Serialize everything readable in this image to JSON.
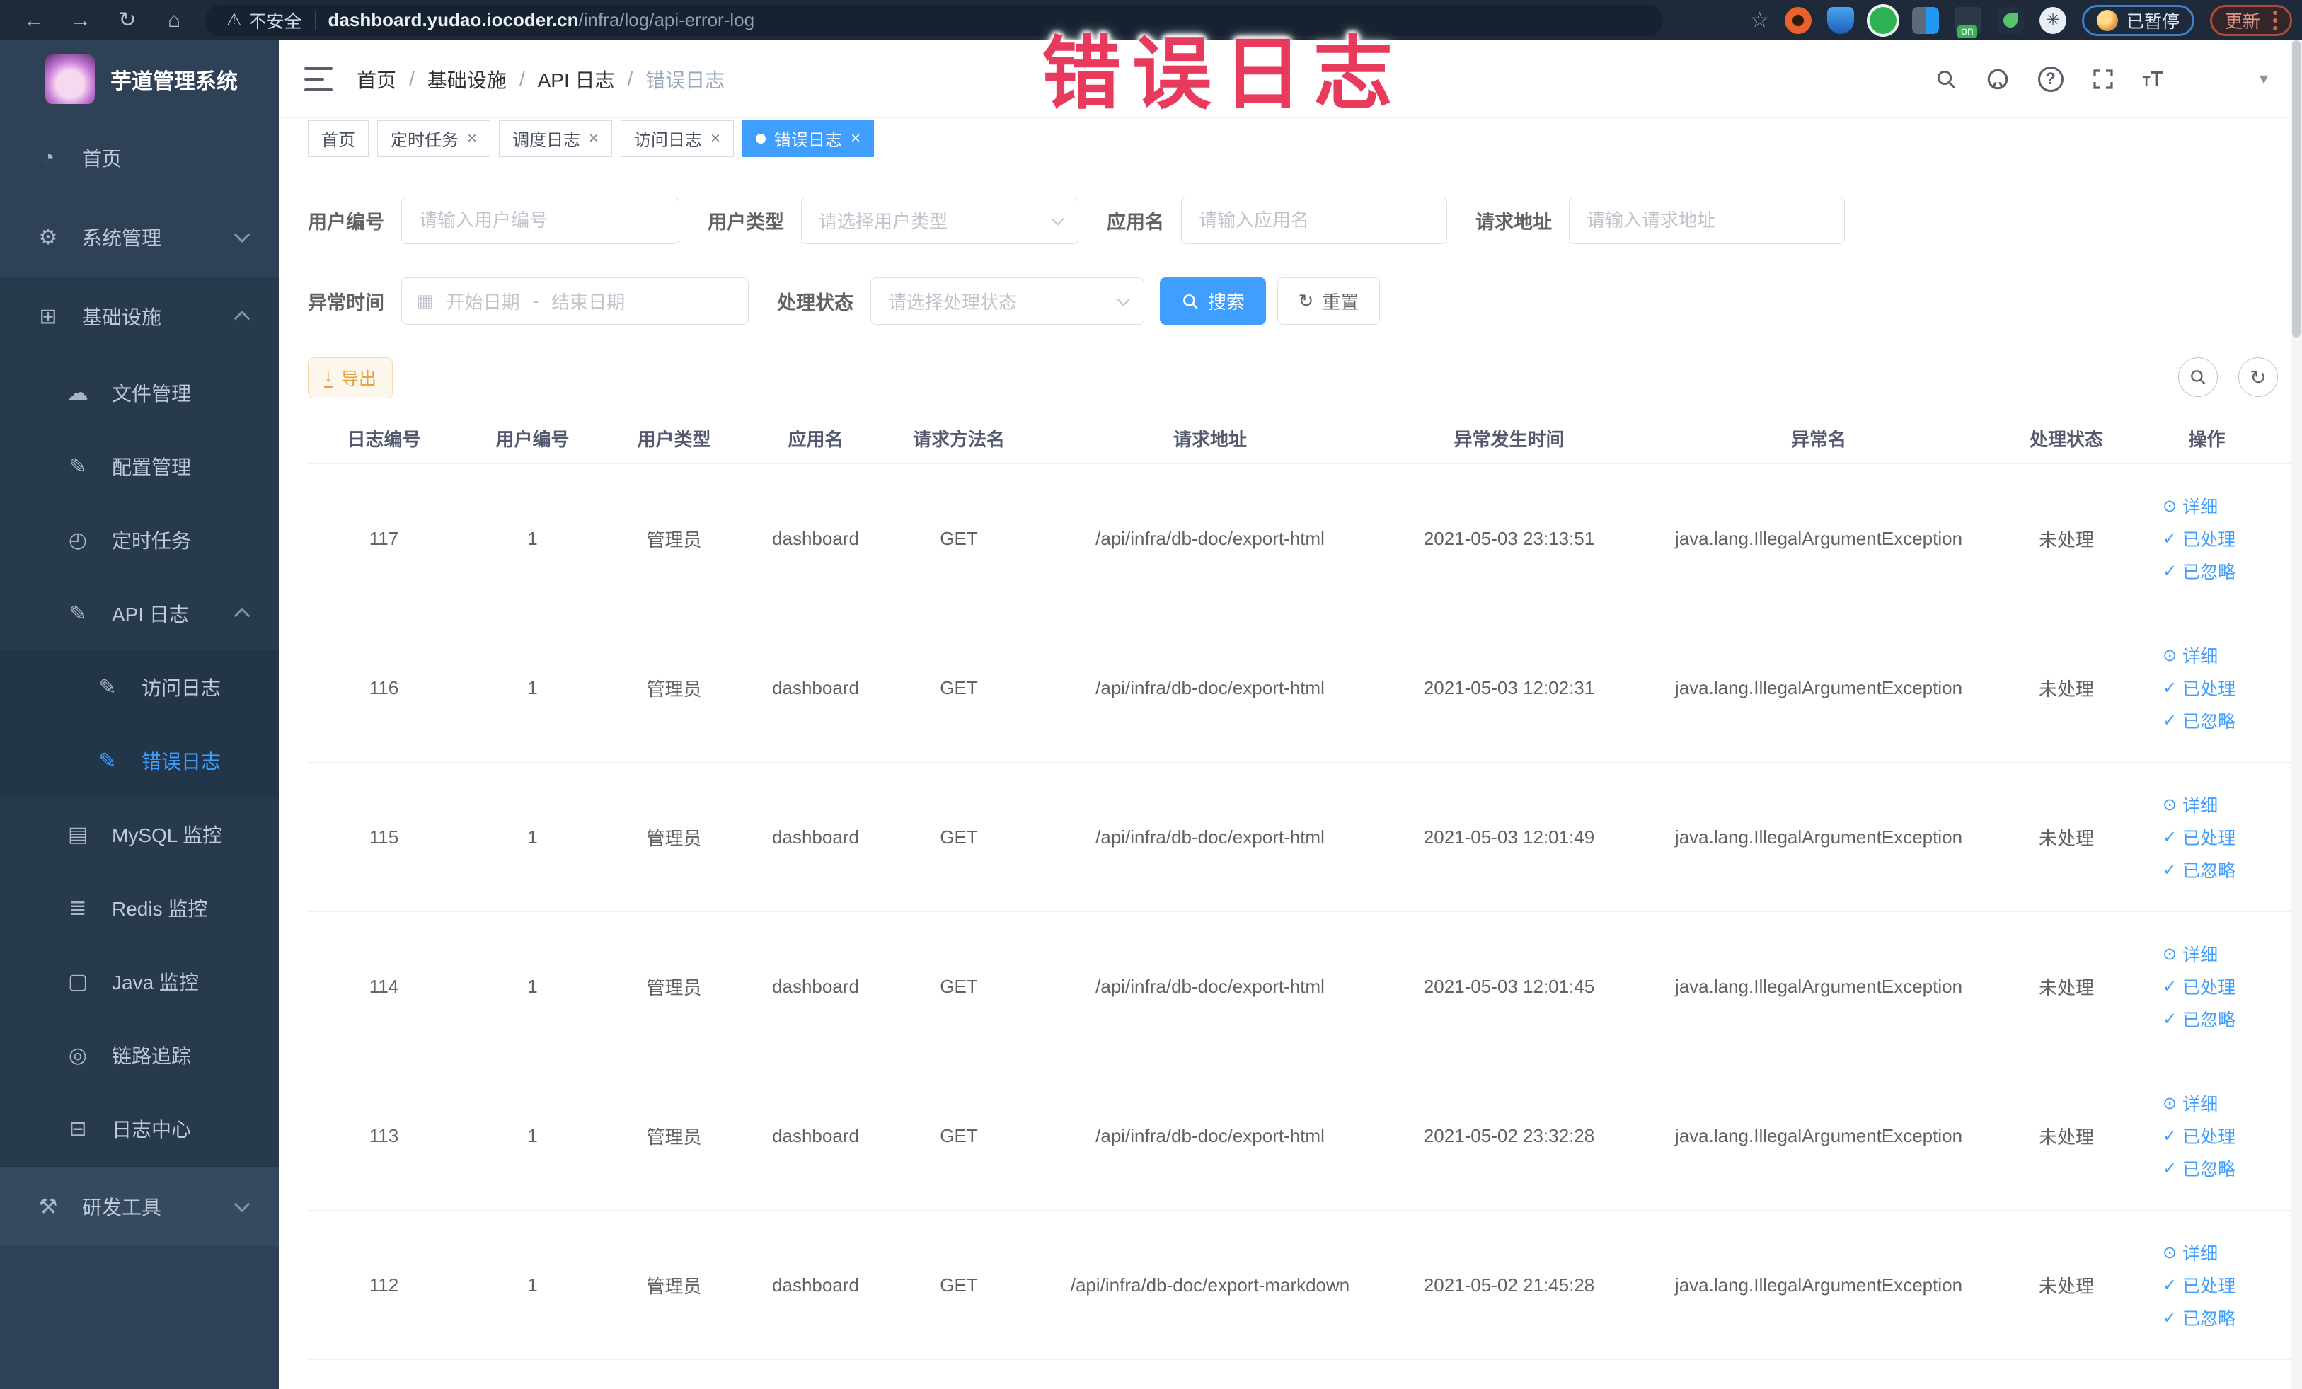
{
  "browser": {
    "insecure_label": "不安全",
    "url_domain": "dashboard.yudao.iocoder.cn",
    "url_path": "/infra/log/api-error-log",
    "paused_label": "已暂停",
    "update_label": "更新"
  },
  "overlay": {
    "text": "错误日志",
    "color": "#e83a5c"
  },
  "sidebar": {
    "title": "芋道管理系统",
    "items": [
      {
        "label": "首页"
      },
      {
        "label": "系统管理"
      },
      {
        "label": "基础设施"
      },
      {
        "label": "文件管理"
      },
      {
        "label": "配置管理"
      },
      {
        "label": "定时任务"
      },
      {
        "label": "API 日志"
      },
      {
        "label": "访问日志"
      },
      {
        "label": "错误日志"
      },
      {
        "label": "MySQL 监控"
      },
      {
        "label": "Redis 监控"
      },
      {
        "label": "Java 监控"
      },
      {
        "label": "链路追踪"
      },
      {
        "label": "日志中心"
      },
      {
        "label": "研发工具"
      }
    ]
  },
  "breadcrumb": {
    "items": [
      "首页",
      "基础设施",
      "API 日志",
      "错误日志"
    ],
    "separator": "/"
  },
  "tabs": [
    {
      "label": "首页",
      "closable": false,
      "active": false
    },
    {
      "label": "定时任务",
      "closable": true,
      "active": false
    },
    {
      "label": "调度日志",
      "closable": true,
      "active": false
    },
    {
      "label": "访问日志",
      "closable": true,
      "active": false
    },
    {
      "label": "错误日志",
      "closable": true,
      "active": true
    }
  ],
  "close_glyph": "×",
  "filters": {
    "user_id": {
      "label": "用户编号",
      "placeholder": "请输入用户编号"
    },
    "user_type": {
      "label": "用户类型",
      "placeholder": "请选择用户类型"
    },
    "app_name": {
      "label": "应用名",
      "placeholder": "请输入应用名"
    },
    "request_url": {
      "label": "请求地址",
      "placeholder": "请输入请求地址"
    },
    "exception_time": {
      "label": "异常时间",
      "start_placeholder": "开始日期",
      "separator": "-",
      "end_placeholder": "结束日期"
    },
    "process_status": {
      "label": "处理状态",
      "placeholder": "请选择处理状态"
    },
    "search_label": "搜索",
    "reset_label": "重置"
  },
  "toolbar": {
    "export_label": "导出"
  },
  "table": {
    "headers": [
      "日志编号",
      "用户编号",
      "用户类型",
      "应用名",
      "请求方法名",
      "请求地址",
      "异常发生时间",
      "异常名",
      "处理状态",
      "操作"
    ],
    "action_labels": {
      "detail": "详细",
      "processed": "已处理",
      "ignored": "已忽略"
    },
    "rows": [
      {
        "id": "117",
        "user_id": "1",
        "user_type": "管理员",
        "app": "dashboard",
        "method": "GET",
        "url": "/api/infra/db-doc/export-html",
        "time": "2021-05-03 23:13:51",
        "exception": "java.lang.IllegalArgumentException",
        "status": "未处理"
      },
      {
        "id": "116",
        "user_id": "1",
        "user_type": "管理员",
        "app": "dashboard",
        "method": "GET",
        "url": "/api/infra/db-doc/export-html",
        "time": "2021-05-03 12:02:31",
        "exception": "java.lang.IllegalArgumentException",
        "status": "未处理"
      },
      {
        "id": "115",
        "user_id": "1",
        "user_type": "管理员",
        "app": "dashboard",
        "method": "GET",
        "url": "/api/infra/db-doc/export-html",
        "time": "2021-05-03 12:01:49",
        "exception": "java.lang.IllegalArgumentException",
        "status": "未处理"
      },
      {
        "id": "114",
        "user_id": "1",
        "user_type": "管理员",
        "app": "dashboard",
        "method": "GET",
        "url": "/api/infra/db-doc/export-html",
        "time": "2021-05-03 12:01:45",
        "exception": "java.lang.IllegalArgumentException",
        "status": "未处理"
      },
      {
        "id": "113",
        "user_id": "1",
        "user_type": "管理员",
        "app": "dashboard",
        "method": "GET",
        "url": "/api/infra/db-doc/export-html",
        "time": "2021-05-02 23:32:28",
        "exception": "java.lang.IllegalArgumentException",
        "status": "未处理"
      },
      {
        "id": "112",
        "user_id": "1",
        "user_type": "管理员",
        "app": "dashboard",
        "method": "GET",
        "url": "/api/infra/db-doc/export-markdown",
        "time": "2021-05-02 21:45:28",
        "exception": "java.lang.IllegalArgumentException",
        "status": "未处理"
      }
    ]
  }
}
